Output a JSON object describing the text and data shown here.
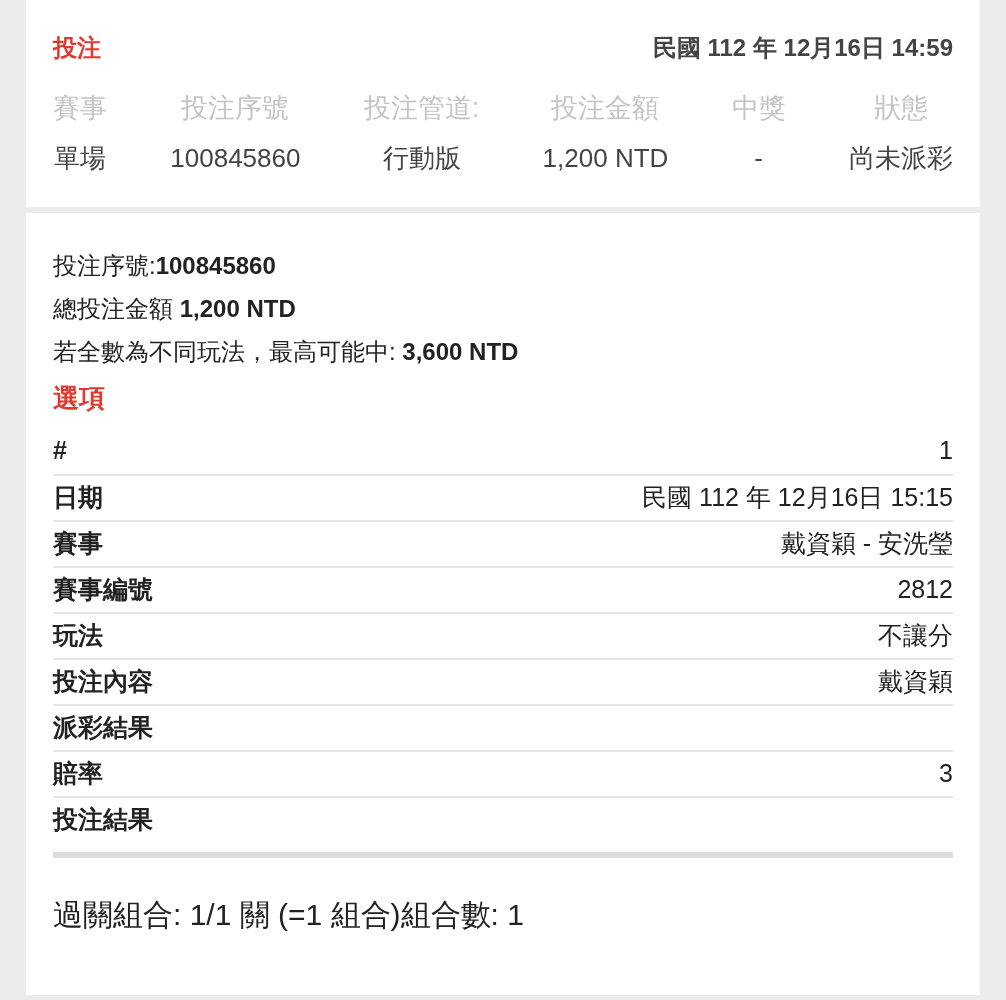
{
  "header": {
    "title": "投注",
    "datetime": "民國 112 年 12月16日 14:59"
  },
  "summary_columns": [
    {
      "label": "賽事",
      "value": "單場"
    },
    {
      "label": "投注序號",
      "value": "100845860"
    },
    {
      "label": "投注管道:",
      "value": "行動版"
    },
    {
      "label": "投注金額",
      "value": "1,200 NTD"
    },
    {
      "label": "中獎",
      "value": "-"
    },
    {
      "label": "狀態",
      "value": "尚未派彩"
    }
  ],
  "details": [
    "投注序號:**100845860**",
    "總投注金額 **1,200 NTD**",
    "若全數為不同玩法，最高可能中: **3,600 NTD**"
  ],
  "options_title": "選項",
  "options_rows": [
    {
      "label": "#",
      "value": "1"
    },
    {
      "label": "日期",
      "value": "民國 112 年 12月16日 15:15"
    },
    {
      "label": "賽事",
      "value": "戴資穎 - 安洗瑩"
    },
    {
      "label": "賽事編號",
      "value": "2812"
    },
    {
      "label": "玩法",
      "value": "不讓分"
    },
    {
      "label": "投注內容",
      "value": "戴資穎"
    },
    {
      "label": "派彩結果"
    },
    {
      "label": "賠率",
      "value": "3"
    },
    {
      "label": "投注結果"
    }
  ],
  "combination": "過關組合: 1/1 關 (=1 組合)組合數: 1"
}
